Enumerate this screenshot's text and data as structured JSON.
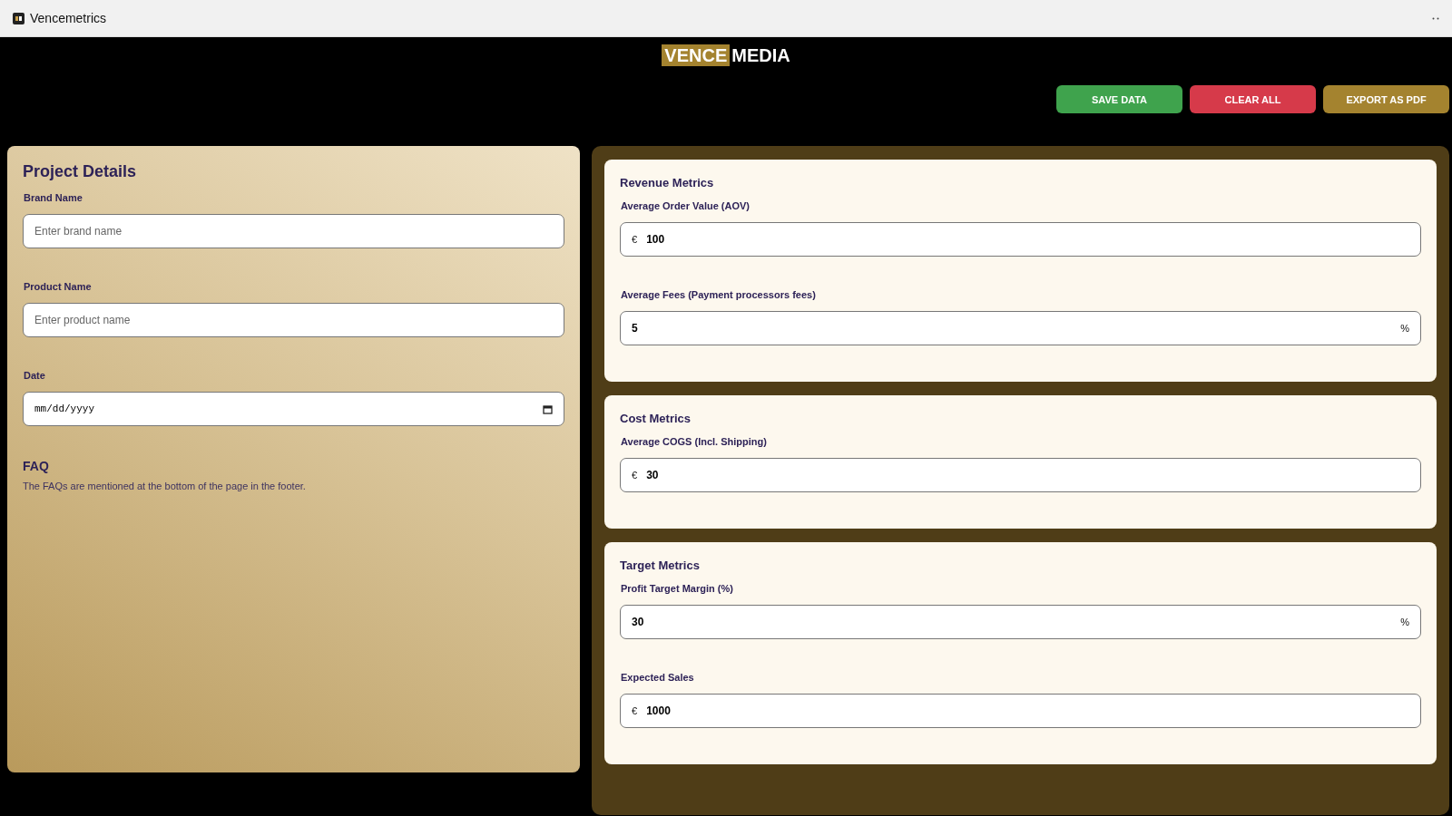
{
  "window": {
    "title": "Vencemetrics"
  },
  "logo": {
    "part_1": "VENCE",
    "part_2": "MEDIA"
  },
  "actions": [
    {
      "label": "SAVE DATA",
      "color": "#3fa34d"
    },
    {
      "label": "CLEAR ALL",
      "color": "#d63a4a"
    },
    {
      "label": "EXPORT AS PDF",
      "color": "#a4832f"
    }
  ],
  "project": {
    "title": "Project Details",
    "fields": [
      {
        "label": "Brand Name",
        "kind": "text",
        "placeholder": "Enter brand name"
      },
      {
        "label": "Product Name",
        "kind": "text",
        "placeholder": "Enter product name"
      },
      {
        "label": "Date",
        "kind": "date",
        "placeholder": "mm/dd/yyyy"
      }
    ],
    "faq": {
      "title": "FAQ",
      "text": "The FAQs are mentioned at the bottom of the page in the footer."
    }
  },
  "sections": [
    {
      "title": "Revenue Metrics",
      "fields": [
        {
          "label": "Average Order Value (AOV)",
          "kind": "prefix",
          "affix": "€",
          "value": "100"
        },
        {
          "label": "Average Fees (Payment processors fees)",
          "kind": "suffix",
          "affix": "%",
          "value": "5"
        }
      ]
    },
    {
      "title": "Cost Metrics",
      "fields": [
        {
          "label": "Average COGS (Incl. Shipping)",
          "kind": "prefix",
          "affix": "€",
          "value": "30"
        }
      ]
    },
    {
      "title": "Target Metrics",
      "fields": [
        {
          "label": "Profit Target Margin (%)",
          "kind": "suffix",
          "affix": "%",
          "value": "30"
        },
        {
          "label": "Expected Sales",
          "kind": "prefix",
          "affix": "€",
          "value": "1000"
        }
      ]
    }
  ]
}
